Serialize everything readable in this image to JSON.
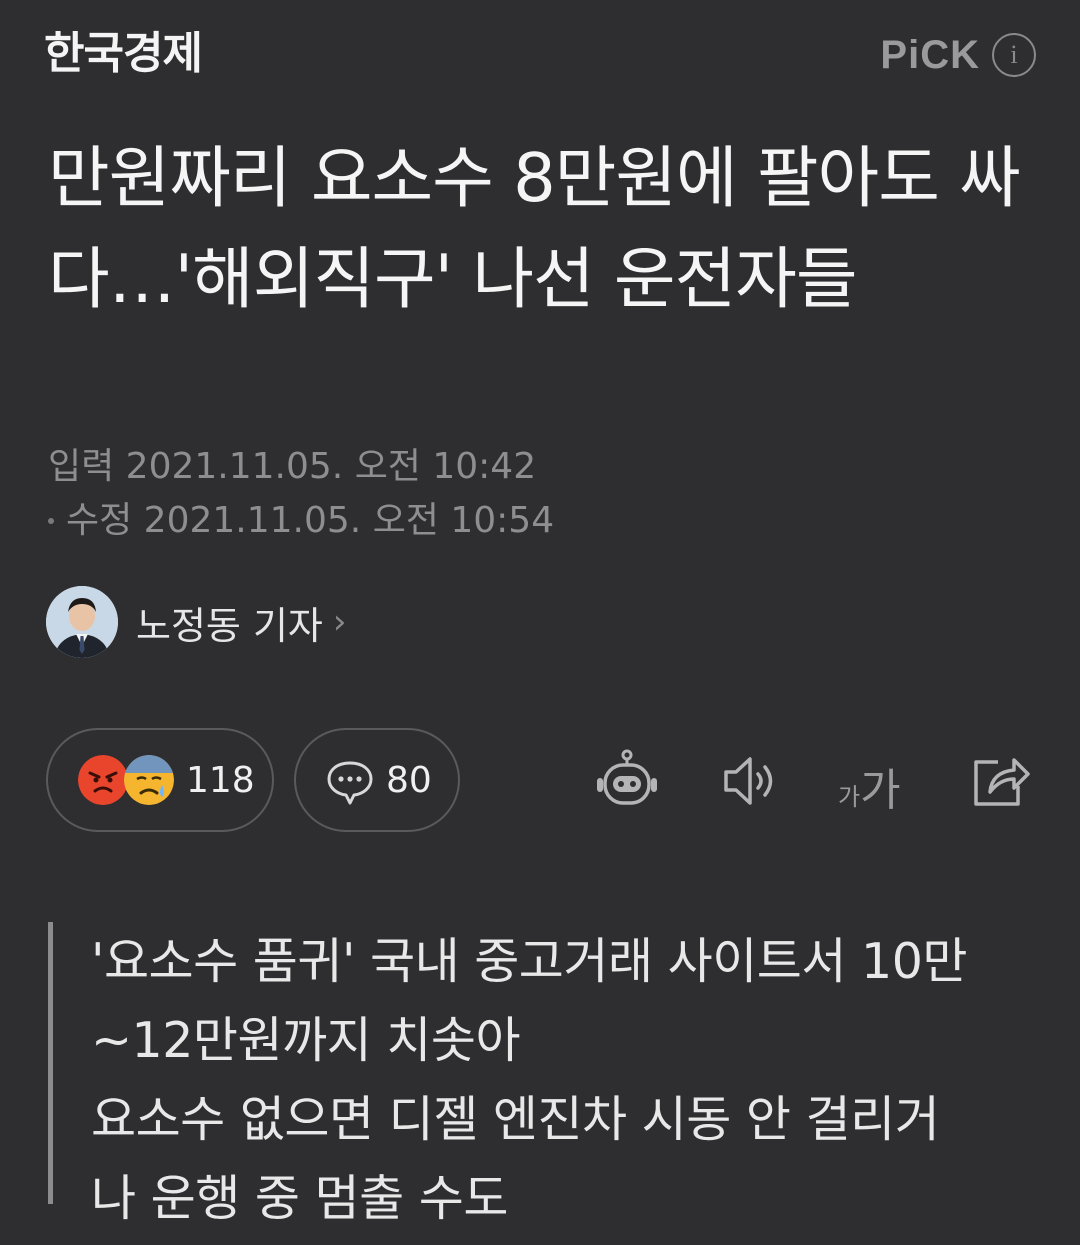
{
  "header": {
    "press_name": "한국경제",
    "pick_label": "PiCK",
    "info_icon": "info-icon"
  },
  "article": {
    "headline": "만원짜리 요소수 8만원에 팔아도 싸다…'해외직구' 나선 운전자들",
    "input_time": "입력 2021.11.05. 오전 10:42",
    "modified_time": "수정 2021.11.05. 오전 10:54"
  },
  "reporter": {
    "name": "노정동 기자",
    "chevron": "›"
  },
  "actions": {
    "reaction_count": "118",
    "comment_count": "80",
    "font_size_small": "가",
    "font_size_large": "가"
  },
  "summary": {
    "text": "'요소수 품귀' 국내 중고거래 사이트서 10만\n~12만원까지 치솟아\n요소수 없으면 디젤 엔진차 시동 안 걸리거\n나 운행 중 멈출 수도"
  },
  "colors": {
    "background": "#2e2e30",
    "text_primary": "#f5f5f5",
    "text_meta": "#8e8e90",
    "pill_border": "#5a5a5c",
    "angry_emoji": "#e8452c",
    "sad_emoji": "#f5b52e"
  }
}
